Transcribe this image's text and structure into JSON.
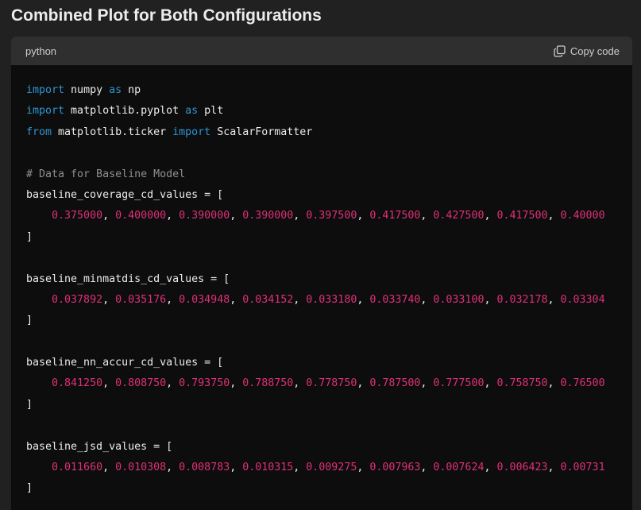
{
  "heading": "Combined Plot for Both Configurations",
  "code_block": {
    "language": "python",
    "copy_label": "Copy code",
    "copy_icon": "copy-icon",
    "colors": {
      "keyword": "#2e95d3",
      "comment": "#8f8f8f",
      "number": "#df3079",
      "text": "#ececec",
      "background": "#0d0d0d",
      "header": "#2f2f2f"
    },
    "lines": [
      {
        "indent": "",
        "tokens": [
          {
            "t": "kw",
            "v": "import"
          },
          {
            "t": "tx",
            "v": " numpy "
          },
          {
            "t": "kw",
            "v": "as"
          },
          {
            "t": "tx",
            "v": " np"
          }
        ]
      },
      {
        "indent": "",
        "tokens": [
          {
            "t": "kw",
            "v": "import"
          },
          {
            "t": "tx",
            "v": " matplotlib.pyplot "
          },
          {
            "t": "kw",
            "v": "as"
          },
          {
            "t": "tx",
            "v": " plt"
          }
        ]
      },
      {
        "indent": "",
        "tokens": [
          {
            "t": "kw",
            "v": "from"
          },
          {
            "t": "tx",
            "v": " matplotlib.ticker "
          },
          {
            "t": "kw",
            "v": "import"
          },
          {
            "t": "tx",
            "v": " ScalarFormatter"
          }
        ]
      },
      {
        "indent": "",
        "tokens": []
      },
      {
        "indent": "",
        "tokens": [
          {
            "t": "cm",
            "v": "# Data for Baseline Model"
          }
        ]
      },
      {
        "indent": "",
        "tokens": [
          {
            "t": "tx",
            "v": "baseline_coverage_cd_values = ["
          }
        ]
      },
      {
        "indent": "    ",
        "tokens": [
          {
            "t": "num",
            "v": "0.375000"
          },
          {
            "t": "tx",
            "v": ", "
          },
          {
            "t": "num",
            "v": "0.400000"
          },
          {
            "t": "tx",
            "v": ", "
          },
          {
            "t": "num",
            "v": "0.390000"
          },
          {
            "t": "tx",
            "v": ", "
          },
          {
            "t": "num",
            "v": "0.390000"
          },
          {
            "t": "tx",
            "v": ", "
          },
          {
            "t": "num",
            "v": "0.397500"
          },
          {
            "t": "tx",
            "v": ", "
          },
          {
            "t": "num",
            "v": "0.417500"
          },
          {
            "t": "tx",
            "v": ", "
          },
          {
            "t": "num",
            "v": "0.427500"
          },
          {
            "t": "tx",
            "v": ", "
          },
          {
            "t": "num",
            "v": "0.417500"
          },
          {
            "t": "tx",
            "v": ", "
          },
          {
            "t": "num",
            "v": "0.40000"
          }
        ]
      },
      {
        "indent": "",
        "tokens": [
          {
            "t": "tx",
            "v": "]"
          }
        ]
      },
      {
        "indent": "",
        "tokens": []
      },
      {
        "indent": "",
        "tokens": [
          {
            "t": "tx",
            "v": "baseline_minmatdis_cd_values = ["
          }
        ]
      },
      {
        "indent": "    ",
        "tokens": [
          {
            "t": "num",
            "v": "0.037892"
          },
          {
            "t": "tx",
            "v": ", "
          },
          {
            "t": "num",
            "v": "0.035176"
          },
          {
            "t": "tx",
            "v": ", "
          },
          {
            "t": "num",
            "v": "0.034948"
          },
          {
            "t": "tx",
            "v": ", "
          },
          {
            "t": "num",
            "v": "0.034152"
          },
          {
            "t": "tx",
            "v": ", "
          },
          {
            "t": "num",
            "v": "0.033180"
          },
          {
            "t": "tx",
            "v": ", "
          },
          {
            "t": "num",
            "v": "0.033740"
          },
          {
            "t": "tx",
            "v": ", "
          },
          {
            "t": "num",
            "v": "0.033100"
          },
          {
            "t": "tx",
            "v": ", "
          },
          {
            "t": "num",
            "v": "0.032178"
          },
          {
            "t": "tx",
            "v": ", "
          },
          {
            "t": "num",
            "v": "0.03304"
          }
        ]
      },
      {
        "indent": "",
        "tokens": [
          {
            "t": "tx",
            "v": "]"
          }
        ]
      },
      {
        "indent": "",
        "tokens": []
      },
      {
        "indent": "",
        "tokens": [
          {
            "t": "tx",
            "v": "baseline_nn_accur_cd_values = ["
          }
        ]
      },
      {
        "indent": "    ",
        "tokens": [
          {
            "t": "num",
            "v": "0.841250"
          },
          {
            "t": "tx",
            "v": ", "
          },
          {
            "t": "num",
            "v": "0.808750"
          },
          {
            "t": "tx",
            "v": ", "
          },
          {
            "t": "num",
            "v": "0.793750"
          },
          {
            "t": "tx",
            "v": ", "
          },
          {
            "t": "num",
            "v": "0.788750"
          },
          {
            "t": "tx",
            "v": ", "
          },
          {
            "t": "num",
            "v": "0.778750"
          },
          {
            "t": "tx",
            "v": ", "
          },
          {
            "t": "num",
            "v": "0.787500"
          },
          {
            "t": "tx",
            "v": ", "
          },
          {
            "t": "num",
            "v": "0.777500"
          },
          {
            "t": "tx",
            "v": ", "
          },
          {
            "t": "num",
            "v": "0.758750"
          },
          {
            "t": "tx",
            "v": ", "
          },
          {
            "t": "num",
            "v": "0.76500"
          }
        ]
      },
      {
        "indent": "",
        "tokens": [
          {
            "t": "tx",
            "v": "]"
          }
        ]
      },
      {
        "indent": "",
        "tokens": []
      },
      {
        "indent": "",
        "tokens": [
          {
            "t": "tx",
            "v": "baseline_jsd_values = ["
          }
        ]
      },
      {
        "indent": "    ",
        "tokens": [
          {
            "t": "num",
            "v": "0.011660"
          },
          {
            "t": "tx",
            "v": ", "
          },
          {
            "t": "num",
            "v": "0.010308"
          },
          {
            "t": "tx",
            "v": ", "
          },
          {
            "t": "num",
            "v": "0.008783"
          },
          {
            "t": "tx",
            "v": ", "
          },
          {
            "t": "num",
            "v": "0.010315"
          },
          {
            "t": "tx",
            "v": ", "
          },
          {
            "t": "num",
            "v": "0.009275"
          },
          {
            "t": "tx",
            "v": ", "
          },
          {
            "t": "num",
            "v": "0.007963"
          },
          {
            "t": "tx",
            "v": ", "
          },
          {
            "t": "num",
            "v": "0.007624"
          },
          {
            "t": "tx",
            "v": ", "
          },
          {
            "t": "num",
            "v": "0.006423"
          },
          {
            "t": "tx",
            "v": ", "
          },
          {
            "t": "num",
            "v": "0.00731"
          }
        ]
      },
      {
        "indent": "",
        "tokens": [
          {
            "t": "tx",
            "v": "]"
          }
        ]
      }
    ]
  }
}
